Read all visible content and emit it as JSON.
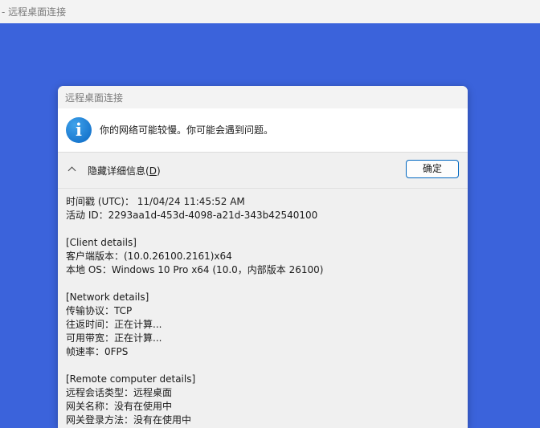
{
  "window": {
    "title": "- 远程桌面连接"
  },
  "dialog": {
    "title": "远程桌面连接",
    "message": "你的网络可能较慢。你可能会遇到问题。",
    "toggle": {
      "label_prefix": "隐藏详细信息(",
      "accel": "D",
      "label_suffix": ")"
    },
    "ok_label": "确定"
  },
  "details": {
    "general": [
      "时间戳 (UTC)：  11/04/24 11:45:52 AM",
      "活动 ID：2293aa1d-453d-4098-a21d-343b42540100"
    ],
    "client_header": "[Client details]",
    "client": [
      "客户端版本：(10.0.26100.2161)x64",
      "本地 OS：Windows 10 Pro x64 (10.0，内部版本 26100)"
    ],
    "network_header": "[Network details]",
    "network": [
      "传输协议：TCP",
      "往返时间：正在计算...",
      "可用带宽：正在计算...",
      "帧速率：0FPS"
    ],
    "remote_header": "[Remote computer details]",
    "remote": [
      "远程会话类型：远程桌面",
      "网关名称：没有在使用中",
      "网关登录方法：没有在使用中"
    ]
  },
  "colors": {
    "desktop": "#3b63db",
    "accent": "#0067c0",
    "info_icon": "#0a67c4"
  },
  "icons": {
    "message": "info-icon",
    "toggle": "chevron-up-icon"
  }
}
